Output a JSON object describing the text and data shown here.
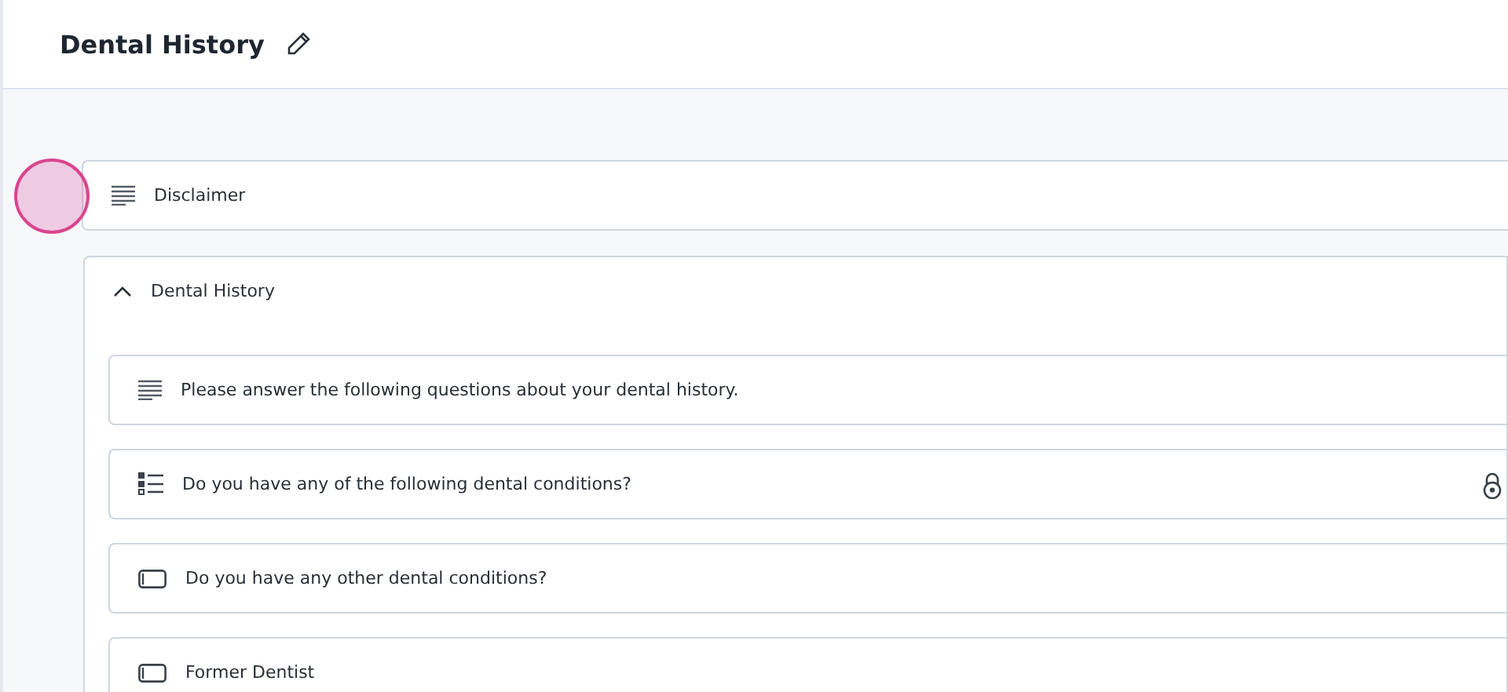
{
  "header": {
    "title": "Dental History"
  },
  "disclaimer": {
    "label": "Disclaimer",
    "kind": "text"
  },
  "click_indicator": {
    "visible": true
  },
  "section": {
    "title": "Dental History",
    "expanded": true,
    "items": [
      {
        "kind": "text",
        "label": "Please answer the following questions about your dental history.",
        "locked": false
      },
      {
        "kind": "choice",
        "label": "Do you have any of the following dental conditions?",
        "locked": true
      },
      {
        "kind": "input",
        "label": "Do you have any other dental conditions?",
        "locked": false
      },
      {
        "kind": "input",
        "label": "Former Dentist",
        "locked": false
      }
    ]
  }
}
